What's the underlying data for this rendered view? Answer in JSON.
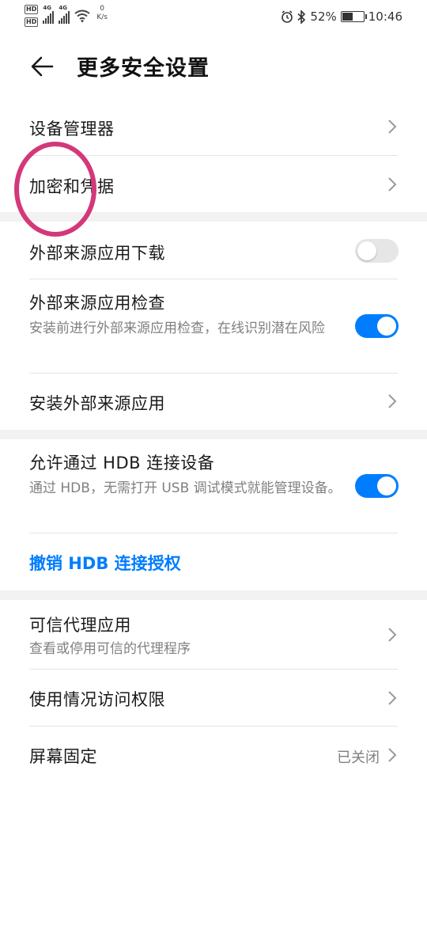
{
  "statusbar": {
    "sim1": "HD",
    "sim2": "HD",
    "net1": "4G",
    "net2": "4G",
    "speed_value": "0",
    "speed_unit": "K/s",
    "battery": "52%",
    "battery_level": 0.52,
    "time": "10:46"
  },
  "header": {
    "title": "更多安全设置"
  },
  "items": {
    "device_manager": "设备管理器",
    "encryption": "加密和凭据",
    "external_download": "外部来源应用下载",
    "external_check": "外部来源应用检查",
    "external_check_desc": "安装前进行外部来源应用检查，在线识别潜在风险",
    "install_external": "安装外部来源应用",
    "hdb_allow": "允许通过 HDB 连接设备",
    "hdb_allow_desc": "通过 HDB，无需打开 USB 调试模式就能管理设备。",
    "hdb_revoke": "撤销 HDB 连接授权",
    "trust_agents": "可信代理应用",
    "trust_agents_desc": "查看或停用可信的代理程序",
    "usage_access": "使用情况访问权限",
    "screen_pinning": "屏幕固定",
    "screen_pinning_value": "已关闭"
  },
  "toggles": {
    "external_download": false,
    "external_check": true,
    "hdb_allow": true
  },
  "colors": {
    "accent": "#007dff",
    "annotation": "#d4387a"
  }
}
